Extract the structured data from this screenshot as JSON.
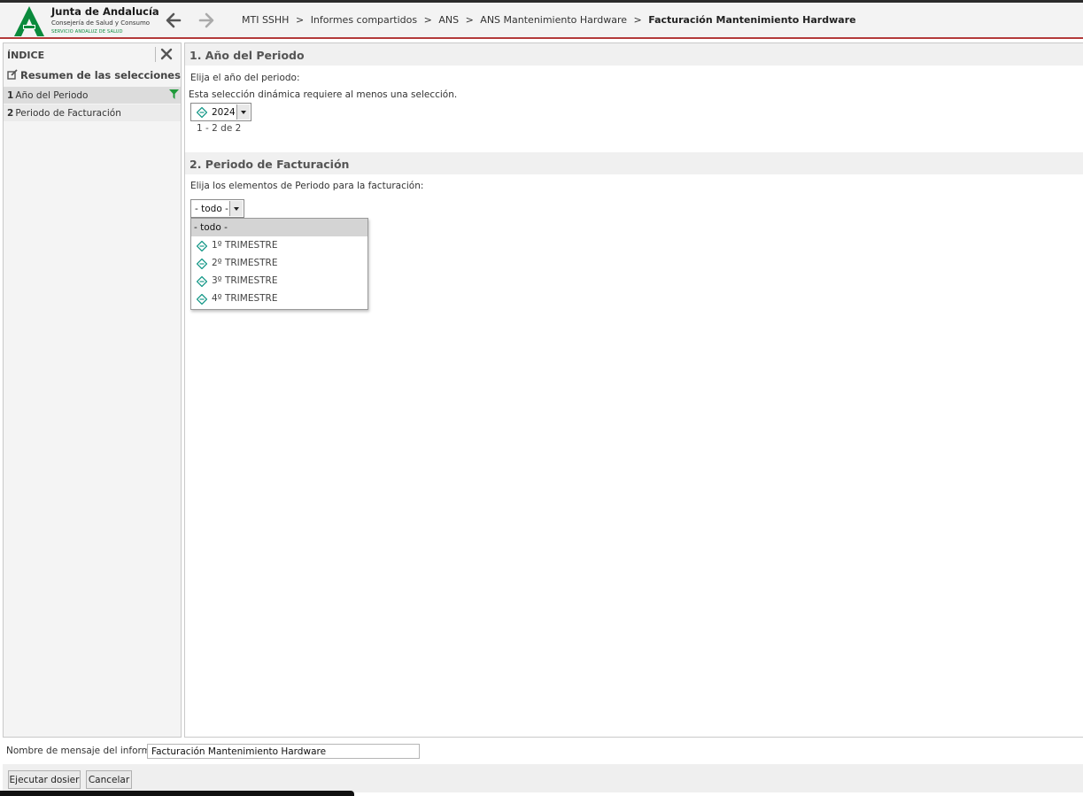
{
  "header": {
    "logo_title": "Junta de Andalucía",
    "logo_subtitle": "Consejería de Salud y Consumo",
    "logo_subtitle2": "SERVICIO ANDALUZ DE SALUD",
    "breadcrumb": [
      "MTI SSHH",
      "Informes compartidos",
      "ANS",
      "ANS Mantenimiento Hardware"
    ],
    "current_page": "Facturación Mantenimiento Hardware",
    "separator": ">"
  },
  "sidebar": {
    "title": "ÍNDICE",
    "summary_label": "Resumen de las selecciones",
    "items": [
      {
        "num": "1",
        "label": "Año del Periodo",
        "selected": true,
        "has_filter": true
      },
      {
        "num": "2",
        "label": "Periodo de Facturación",
        "selected": false,
        "has_filter": false
      }
    ]
  },
  "section1": {
    "title": "1.  Año del Periodo",
    "prompt": "Elija el año del periodo:",
    "requirement": "Esta selección dinámica requiere al menos una selección.",
    "selected_value": "2024",
    "count_text": "1 - 2 de 2"
  },
  "section2": {
    "title": "2.  Periodo de Facturación",
    "prompt": "Elija los elementos de Periodo para la facturación:",
    "selected_value": "- todo -",
    "dropdown_options": [
      "- todo -",
      "1º TRIMESTRE",
      "2º TRIMESTRE",
      "3º TRIMESTRE",
      "4º TRIMESTRE"
    ]
  },
  "footer": {
    "name_label": "Nombre de mensaje del informe:",
    "name_value": "Facturación Mantenimiento Hardware",
    "run_button": "Ejecutar dosier",
    "cancel_button": "Cancelar"
  },
  "colors": {
    "accent_green": "#0a8a3c",
    "header_border": "#b33a3a",
    "diamond_teal": "#1a9a8a"
  },
  "icons": [
    "junta-andalucia-logo",
    "back-arrow-icon",
    "forward-arrow-icon",
    "close-icon",
    "summary-icon",
    "filter-icon",
    "diamond-attribute-icon",
    "dropdown-arrow-icon"
  ]
}
